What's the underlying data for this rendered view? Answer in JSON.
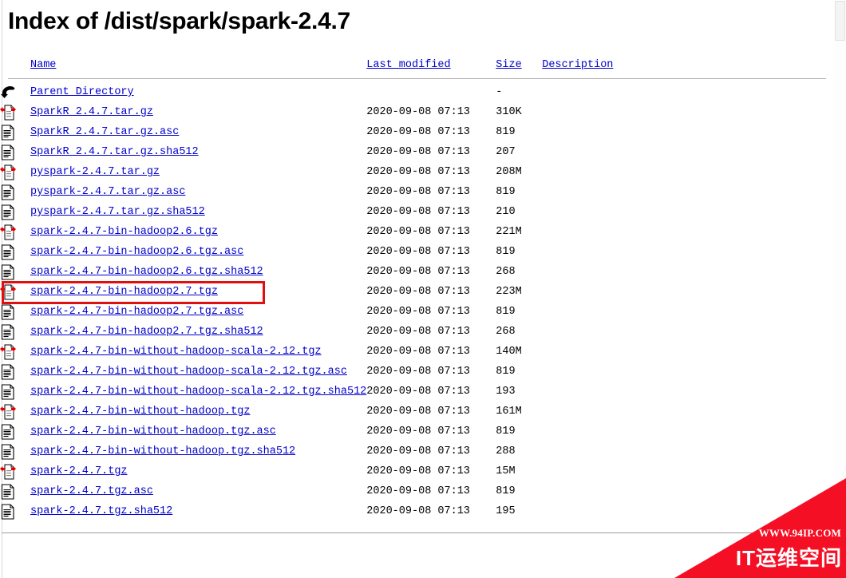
{
  "page": {
    "title": "Index of /dist/spark/spark-2.4.7"
  },
  "table": {
    "headers": {
      "icon": "",
      "name": "Name",
      "last_modified": "Last modified",
      "size": "Size",
      "description": "Description"
    },
    "rows": [
      {
        "icon": "back-icon",
        "name": "Parent Directory",
        "last_modified": "",
        "size": "-",
        "description": ""
      },
      {
        "icon": "compressed-icon",
        "name": "SparkR_2.4.7.tar.gz",
        "last_modified": "2020-09-08 07:13",
        "size": "310K",
        "description": ""
      },
      {
        "icon": "text-icon",
        "name": "SparkR_2.4.7.tar.gz.asc",
        "last_modified": "2020-09-08 07:13",
        "size": "819",
        "description": ""
      },
      {
        "icon": "text-icon",
        "name": "SparkR_2.4.7.tar.gz.sha512",
        "last_modified": "2020-09-08 07:13",
        "size": "207",
        "description": ""
      },
      {
        "icon": "compressed-icon",
        "name": "pyspark-2.4.7.tar.gz",
        "last_modified": "2020-09-08 07:13",
        "size": "208M",
        "description": ""
      },
      {
        "icon": "text-icon",
        "name": "pyspark-2.4.7.tar.gz.asc",
        "last_modified": "2020-09-08 07:13",
        "size": "819",
        "description": ""
      },
      {
        "icon": "text-icon",
        "name": "pyspark-2.4.7.tar.gz.sha512",
        "last_modified": "2020-09-08 07:13",
        "size": "210",
        "description": ""
      },
      {
        "icon": "compressed-icon",
        "name": "spark-2.4.7-bin-hadoop2.6.tgz",
        "last_modified": "2020-09-08 07:13",
        "size": "221M",
        "description": ""
      },
      {
        "icon": "text-icon",
        "name": "spark-2.4.7-bin-hadoop2.6.tgz.asc",
        "last_modified": "2020-09-08 07:13",
        "size": "819",
        "description": ""
      },
      {
        "icon": "text-icon",
        "name": "spark-2.4.7-bin-hadoop2.6.tgz.sha512",
        "last_modified": "2020-09-08 07:13",
        "size": "268",
        "description": ""
      },
      {
        "icon": "compressed-icon",
        "name": "spark-2.4.7-bin-hadoop2.7.tgz",
        "last_modified": "2020-09-08 07:13",
        "size": "223M",
        "description": "",
        "highlighted": true
      },
      {
        "icon": "text-icon",
        "name": "spark-2.4.7-bin-hadoop2.7.tgz.asc",
        "last_modified": "2020-09-08 07:13",
        "size": "819",
        "description": ""
      },
      {
        "icon": "text-icon",
        "name": "spark-2.4.7-bin-hadoop2.7.tgz.sha512",
        "last_modified": "2020-09-08 07:13",
        "size": "268",
        "description": ""
      },
      {
        "icon": "compressed-icon",
        "name": "spark-2.4.7-bin-without-hadoop-scala-2.12.tgz",
        "last_modified": "2020-09-08 07:13",
        "size": "140M",
        "description": ""
      },
      {
        "icon": "text-icon",
        "name": "spark-2.4.7-bin-without-hadoop-scala-2.12.tgz.asc",
        "last_modified": "2020-09-08 07:13",
        "size": "819",
        "description": ""
      },
      {
        "icon": "text-icon",
        "name": "spark-2.4.7-bin-without-hadoop-scala-2.12.tgz.sha512",
        "last_modified": "2020-09-08 07:13",
        "size": "193",
        "description": ""
      },
      {
        "icon": "compressed-icon",
        "name": "spark-2.4.7-bin-without-hadoop.tgz",
        "last_modified": "2020-09-08 07:13",
        "size": "161M",
        "description": ""
      },
      {
        "icon": "text-icon",
        "name": "spark-2.4.7-bin-without-hadoop.tgz.asc",
        "last_modified": "2020-09-08 07:13",
        "size": "819",
        "description": ""
      },
      {
        "icon": "text-icon",
        "name": "spark-2.4.7-bin-without-hadoop.tgz.sha512",
        "last_modified": "2020-09-08 07:13",
        "size": "288",
        "description": ""
      },
      {
        "icon": "compressed-icon",
        "name": "spark-2.4.7.tgz",
        "last_modified": "2020-09-08 07:13",
        "size": "15M",
        "description": ""
      },
      {
        "icon": "text-icon",
        "name": "spark-2.4.7.tgz.asc",
        "last_modified": "2020-09-08 07:13",
        "size": "819",
        "description": ""
      },
      {
        "icon": "text-icon",
        "name": "spark-2.4.7.tgz.sha512",
        "last_modified": "2020-09-08 07:13",
        "size": "195",
        "description": ""
      }
    ]
  },
  "highlight": {
    "color": "#e01010",
    "target": "spark-2.4.7-bin-hadoop2.7.tgz"
  },
  "watermark": {
    "url": "WWW.94IP.COM",
    "brand": "IT运维空间",
    "color": "#f50f25"
  },
  "colors": {
    "link": "#0000cc",
    "rule": "#b0b0b0",
    "text": "#000000"
  }
}
